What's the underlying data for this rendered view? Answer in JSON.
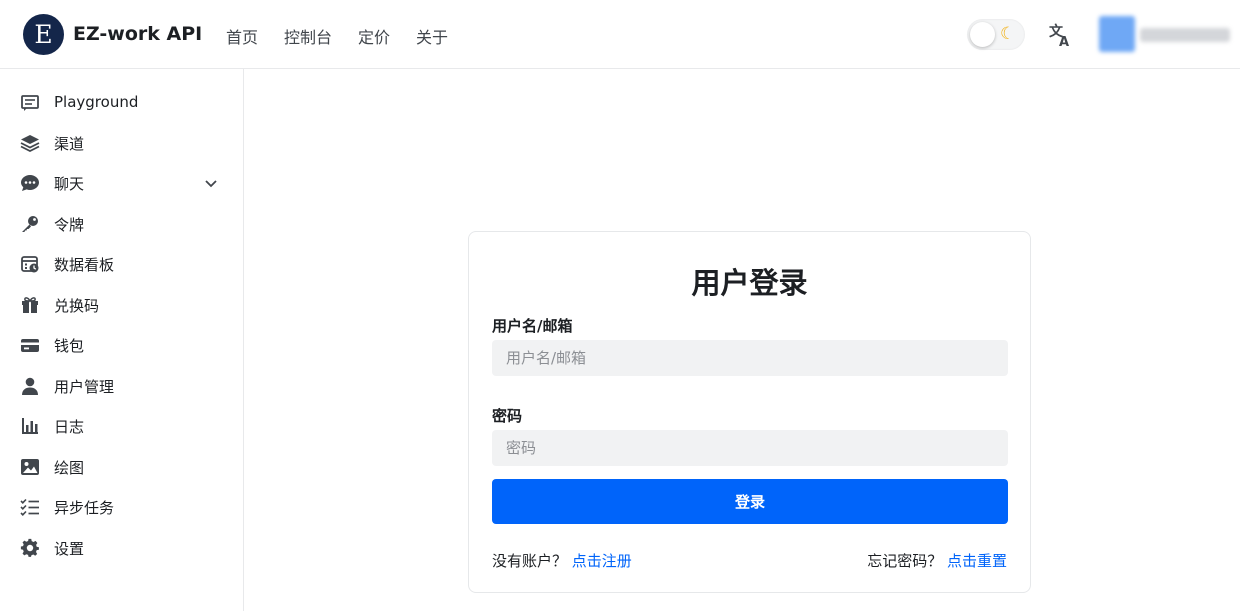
{
  "header": {
    "logo_letter": "E",
    "app_title": "EZ-work API",
    "nav": [
      "首页",
      "控制台",
      "定价",
      "关于"
    ],
    "theme_icon": "moon-icon",
    "lang_icon": "translate-icon"
  },
  "sidebar": {
    "items": [
      {
        "label": "Playground",
        "icon": "message-square-icon"
      },
      {
        "label": "渠道",
        "icon": "layers-icon"
      },
      {
        "label": "聊天",
        "icon": "chat-bubble-icon"
      },
      {
        "label": "令牌",
        "icon": "key-icon"
      },
      {
        "label": "数据看板",
        "icon": "calendar-clock-icon"
      },
      {
        "label": "兑换码",
        "icon": "gift-icon"
      },
      {
        "label": "钱包",
        "icon": "credit-card-icon"
      },
      {
        "label": "用户管理",
        "icon": "user-icon"
      },
      {
        "label": "日志",
        "icon": "bar-chart-icon"
      },
      {
        "label": "绘图",
        "icon": "image-icon"
      },
      {
        "label": "异步任务",
        "icon": "checklist-icon"
      },
      {
        "label": "设置",
        "icon": "gear-icon"
      }
    ]
  },
  "login": {
    "title": "用户登录",
    "username_label": "用户名/邮箱",
    "username_placeholder": "用户名/邮箱",
    "password_label": "密码",
    "password_placeholder": "密码",
    "submit_label": "登录",
    "no_account_text": "没有账户？",
    "register_link": "点击注册",
    "forgot_text": "忘记密码？",
    "reset_link": "点击重置"
  },
  "colors": {
    "primary": "#0064fa",
    "logo_bg": "#14264a",
    "input_bg": "#f1f2f3"
  }
}
